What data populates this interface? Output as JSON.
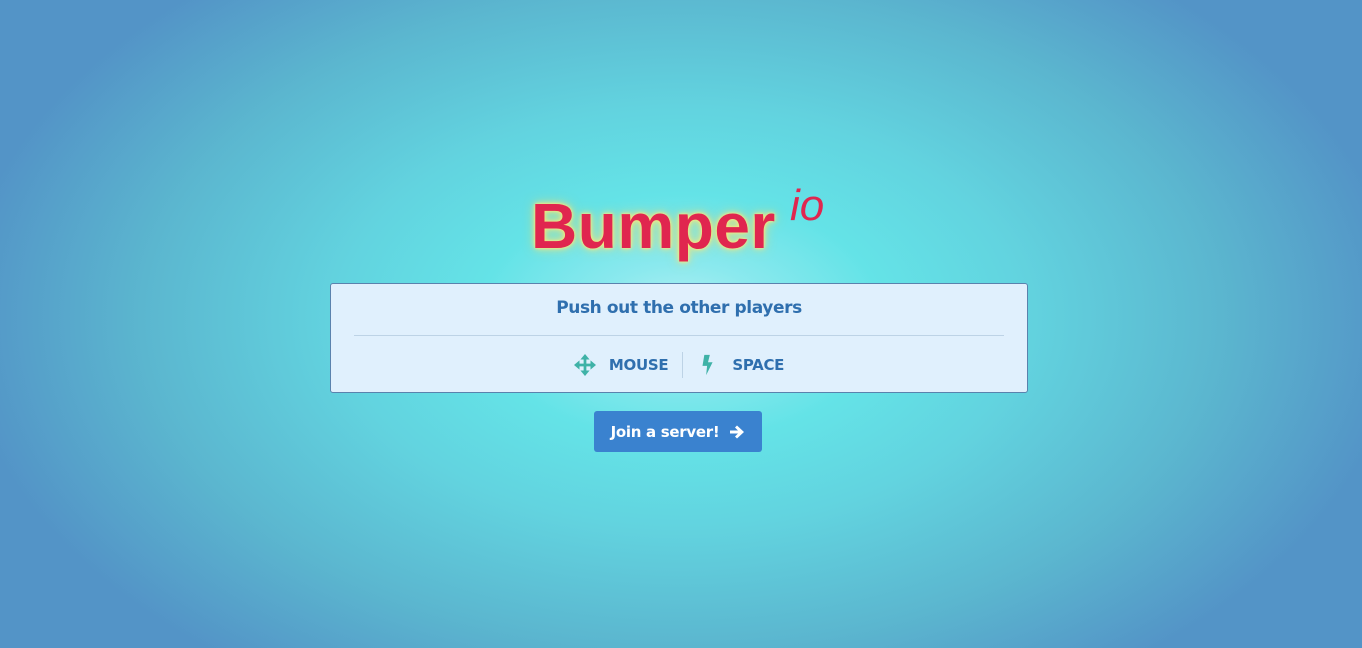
{
  "title": {
    "main": "Bumper",
    "suffix": "io"
  },
  "panel": {
    "heading": "Push out the other players",
    "controls": [
      {
        "icon": "arrows-move-icon",
        "label": "MOUSE"
      },
      {
        "icon": "lightning-icon",
        "label": "SPACE"
      }
    ]
  },
  "join_button": {
    "label": "Join a server!",
    "icon": "arrow-right-icon"
  },
  "colors": {
    "title": "#e0264f",
    "panel_background": "#e0f0fd",
    "panel_text": "#2f6fae",
    "icon_teal": "#3fb2a7",
    "button": "#3a82cf",
    "button_text": "#ffffff"
  }
}
